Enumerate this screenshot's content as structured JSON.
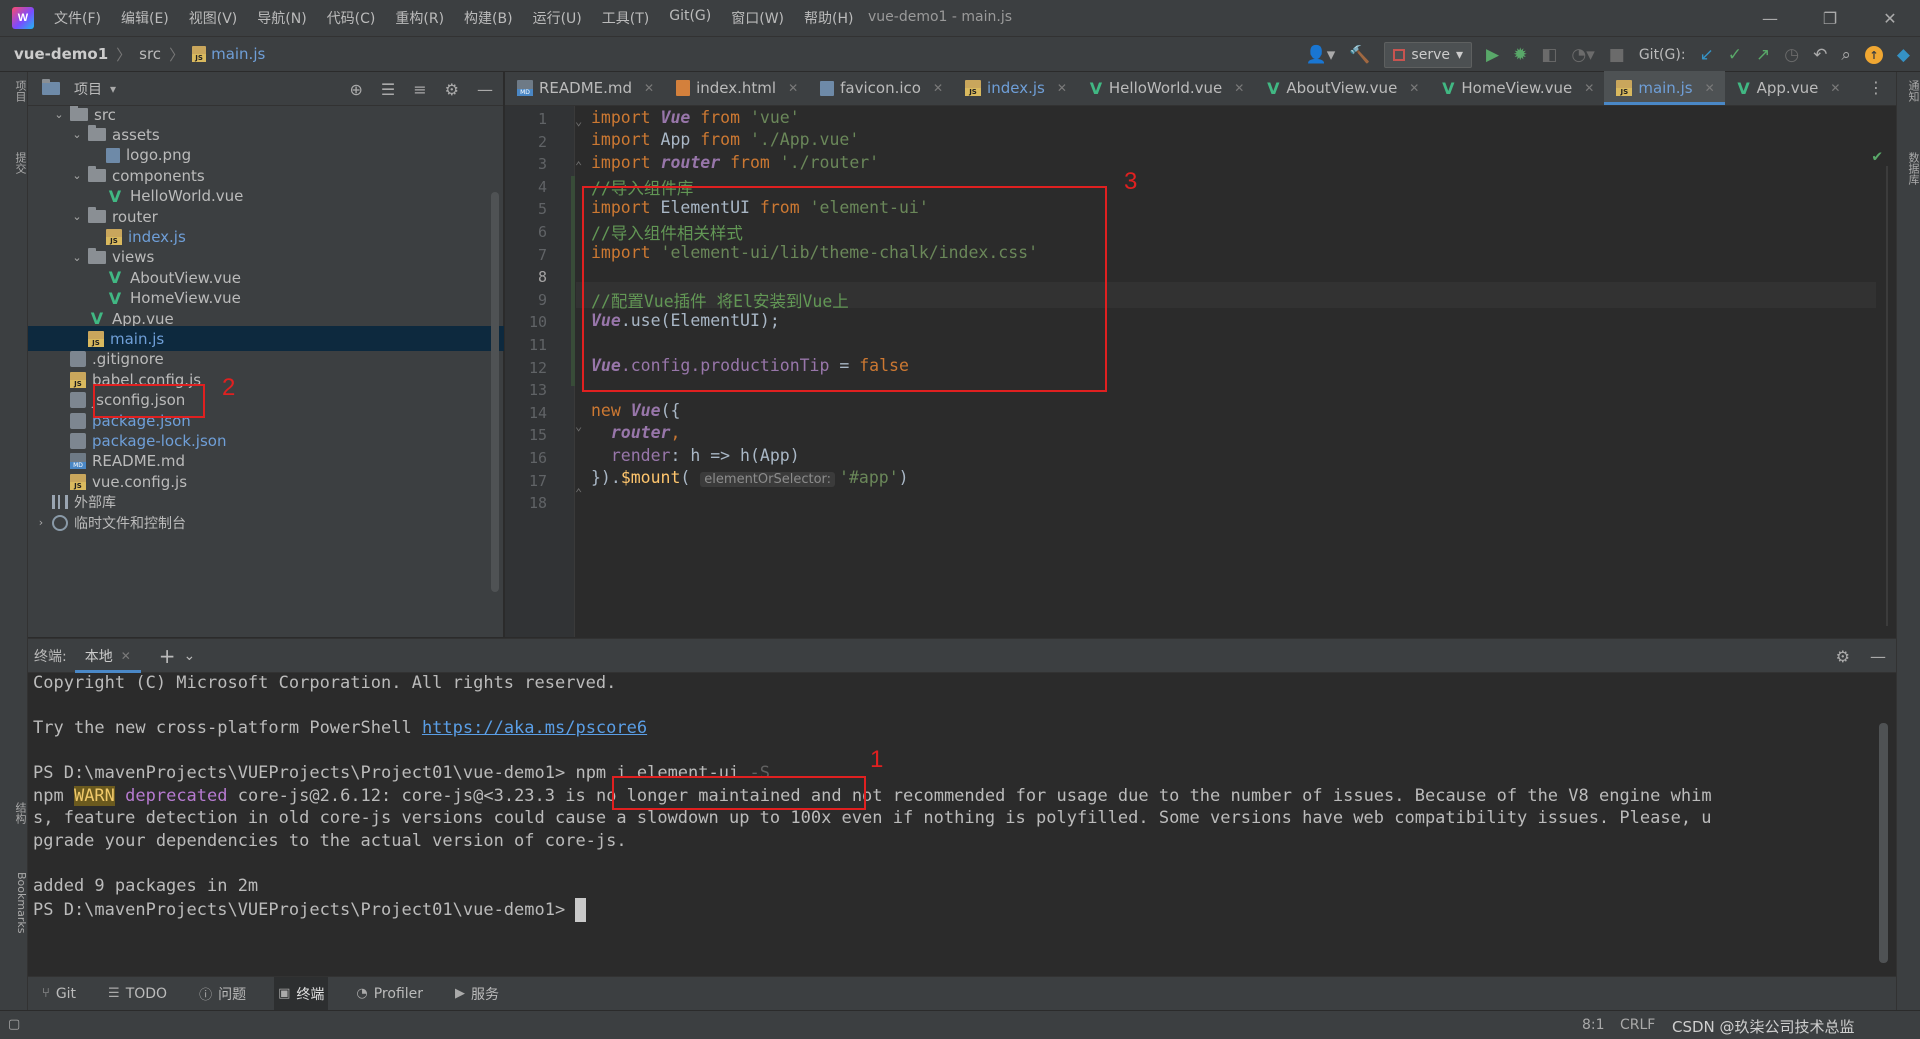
{
  "titlebar": {
    "menu": [
      "文件(F)",
      "编辑(E)",
      "视图(V)",
      "导航(N)",
      "代码(C)",
      "重构(R)",
      "构建(B)",
      "运行(U)",
      "工具(T)",
      "Git(G)",
      "窗口(W)",
      "帮助(H)"
    ],
    "window_title": "vue-demo1 - main.js"
  },
  "navbar": {
    "project": "vue-demo1",
    "folder": "src",
    "file": "main.js",
    "run_config": "serve",
    "git_label": "Git(G):"
  },
  "project_panel": {
    "title": "项目",
    "tree": [
      {
        "label": "src",
        "kind": "folder",
        "level": 1,
        "expanded": true
      },
      {
        "label": "assets",
        "kind": "folder",
        "level": 2,
        "expanded": true
      },
      {
        "label": "logo.png",
        "kind": "image",
        "level": 3
      },
      {
        "label": "components",
        "kind": "folder",
        "level": 2,
        "expanded": true
      },
      {
        "label": "HelloWorld.vue",
        "kind": "vue",
        "level": 3
      },
      {
        "label": "router",
        "kind": "folder",
        "level": 2,
        "expanded": true
      },
      {
        "label": "index.js",
        "kind": "js",
        "level": 3,
        "color": "blue"
      },
      {
        "label": "views",
        "kind": "folder",
        "level": 2,
        "expanded": true
      },
      {
        "label": "AboutView.vue",
        "kind": "vue",
        "level": 3
      },
      {
        "label": "HomeView.vue",
        "kind": "vue",
        "level": 3
      },
      {
        "label": "App.vue",
        "kind": "vue",
        "level": 2
      },
      {
        "label": "main.js",
        "kind": "js",
        "level": 2,
        "color": "blue",
        "selected": true
      },
      {
        "label": ".gitignore",
        "kind": "cfg",
        "level": 1
      },
      {
        "label": "babel.config.js",
        "kind": "js",
        "level": 1
      },
      {
        "label": "jsconfig.json",
        "kind": "cfg",
        "level": 1
      },
      {
        "label": "package.json",
        "kind": "cfg",
        "level": 1,
        "color": "blue"
      },
      {
        "label": "package-lock.json",
        "kind": "cfg",
        "level": 1,
        "color": "blue"
      },
      {
        "label": "README.md",
        "kind": "md",
        "level": 1
      },
      {
        "label": "vue.config.js",
        "kind": "js",
        "level": 1
      },
      {
        "label": "外部库",
        "kind": "lib",
        "level": 0
      },
      {
        "label": "临时文件和控制台",
        "kind": "scratch",
        "level": 0,
        "collapsed": true
      }
    ]
  },
  "editor": {
    "tabs": [
      {
        "label": "README.md",
        "icon": "md"
      },
      {
        "label": "index.html",
        "icon": "html"
      },
      {
        "label": "favicon.ico",
        "icon": "image"
      },
      {
        "label": "index.js",
        "icon": "js",
        "color": "blue"
      },
      {
        "label": "HelloWorld.vue",
        "icon": "vue"
      },
      {
        "label": "AboutView.vue",
        "icon": "vue"
      },
      {
        "label": "HomeView.vue",
        "icon": "vue"
      },
      {
        "label": "main.js",
        "icon": "js",
        "color": "blue",
        "active": true
      },
      {
        "label": "App.vue",
        "icon": "vue"
      }
    ],
    "line_numbers": [
      "1",
      "2",
      "3",
      "4",
      "5",
      "6",
      "7",
      "8",
      "9",
      "10",
      "11",
      "12",
      "13",
      "14",
      "15",
      "16",
      "17",
      "18"
    ],
    "current_line": "8",
    "code": {
      "l1": {
        "kw": "import",
        "cls": "Vue",
        "from": "from",
        "str": "'vue'"
      },
      "l2": {
        "kw": "import",
        "name": "App",
        "from": "from",
        "str": "'./App.vue'"
      },
      "l3": {
        "kw": "import",
        "cls": "router",
        "from": "from",
        "str": "'./router'"
      },
      "l4": {
        "cmt": "//导入组件库"
      },
      "l5": {
        "kw": "import",
        "name": "ElementUI",
        "from": "from",
        "str": "'element-ui'"
      },
      "l6": {
        "cmt": "//导入组件相关样式"
      },
      "l7": {
        "kw": "import",
        "str": "'element-ui/lib/theme-chalk/index.css'"
      },
      "l9": {
        "cmt": "//配置Vue插件 将El安装到Vue上"
      },
      "l10": {
        "cls": "Vue",
        "rest": ".use(ElementUI);"
      },
      "l12": {
        "cls": "Vue",
        "fld": ".config.productionTip",
        "eq": " = ",
        "kw": "false"
      },
      "l14": {
        "kw": "new",
        "cls": "Vue",
        "rest": "({"
      },
      "l15": {
        "prm": "router",
        "rest": ","
      },
      "l16": {
        "fld": "render",
        "rest": ": h => h(App)"
      },
      "l17": {
        "pre": "}).",
        "fn": "$mount",
        "open": "(",
        "hint": "elementOrSelector:",
        "str": "'#app'",
        "close": ")"
      }
    }
  },
  "terminal": {
    "title": "终端:",
    "tab": "本地",
    "lines": {
      "copyright": "Copyright (C) Microsoft Corporation. All rights reserved.",
      "try_prefix": "Try the new cross-platform PowerShell ",
      "try_link": "https://aka.ms/pscore6",
      "prompt1": "PS D:\\mavenProjects\\VUEProjects\\Project01\\vue-demo1>",
      "cmd": " npm i element-ui ",
      "cmd_flag": "-S",
      "npm": "npm ",
      "warn": "WARN",
      "deprecated": " deprecated",
      "warn_msg": " core-js@2.6.12: core-js@<3.23.3 is no longer maintained and not recommended for usage due to the number of issues. Because of the V8 engine whim",
      "warn_cont1": "s, feature detection in old core-js versions could cause a slowdown up to 100x even if nothing is polyfilled. Some versions have web compatibility issues. Please, u",
      "warn_cont2": "pgrade your dependencies to the actual version of core-js.",
      "added": "added 9 packages in 2m",
      "prompt2": "PS D:\\mavenProjects\\VUEProjects\\Project01\\vue-demo1> "
    }
  },
  "tool_windows": [
    {
      "label": "Git",
      "icon": "branch-icon"
    },
    {
      "label": "TODO",
      "icon": "list-icon"
    },
    {
      "label": "问题",
      "icon": "info-icon"
    },
    {
      "label": "终端",
      "icon": "terminal-icon",
      "active": true
    },
    {
      "label": "Profiler",
      "icon": "profiler-icon"
    },
    {
      "label": "服务",
      "icon": "play-icon"
    }
  ],
  "left_strip": {
    "project": "项目",
    "commit": "提交",
    "structure": "结构",
    "bookmarks": "Bookmarks"
  },
  "right_strip": {
    "notifications": "通知",
    "database": "数据库"
  },
  "annotations": {
    "n1": "1",
    "n2": "2",
    "n3": "3"
  },
  "statusbar": {
    "position": "8:1",
    "line_sep": "CRLF",
    "watermark": "CSDN @玖柒公司技术总监"
  },
  "colors": {
    "accent": "#4a88c7",
    "annotation": "#e02020",
    "vue": "#41b883"
  }
}
